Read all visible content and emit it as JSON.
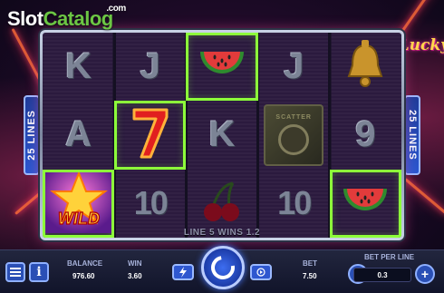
{
  "brand": {
    "name_part1": "Slot",
    "name_part2": "Catalog",
    "suffix": ".com"
  },
  "game_title": "Lucky",
  "lines_indicator": {
    "left": "25 LINES",
    "right": "25 LINES"
  },
  "reels": [
    [
      {
        "symbol": "K",
        "kind": "letter",
        "win": false
      },
      {
        "symbol": "J",
        "kind": "letter",
        "win": false
      },
      {
        "symbol": "watermelon",
        "kind": "watermelon",
        "win": true
      },
      {
        "symbol": "J",
        "kind": "letter",
        "win": false
      },
      {
        "symbol": "bell",
        "kind": "bell",
        "win": false
      }
    ],
    [
      {
        "symbol": "A",
        "kind": "letter",
        "win": false
      },
      {
        "symbol": "7",
        "kind": "seven",
        "win": true
      },
      {
        "symbol": "K",
        "kind": "letter",
        "win": false
      },
      {
        "symbol": "SCATTER",
        "kind": "scatter",
        "win": false
      },
      {
        "symbol": "9",
        "kind": "letter",
        "win": false
      }
    ],
    [
      {
        "symbol": "WILD",
        "kind": "wild",
        "win": true
      },
      {
        "symbol": "10",
        "kind": "number",
        "win": false
      },
      {
        "symbol": "cherries",
        "kind": "cherries",
        "win": false
      },
      {
        "symbol": "10",
        "kind": "number",
        "win": false
      },
      {
        "symbol": "watermelon",
        "kind": "watermelon",
        "win": true
      }
    ]
  ],
  "line_win_text": "LINE 5 WINS 1.2",
  "bottom_bar": {
    "menu_icon": "menu-icon",
    "info_label": "i",
    "balance_label": "BALANCE",
    "balance_value": "976.60",
    "win_label": "WIN",
    "win_value": "3.60",
    "bet_label": "BET",
    "bet_value": "7.50",
    "bet_per_line_label": "BET PER LINE",
    "bet_per_line_value": "0.3",
    "minus_label": "−",
    "plus_label": "+",
    "turbo_icon": "lightning-icon",
    "spin_icon": "spin-icon",
    "autoplay_icon": "autoplay-icon"
  },
  "colors": {
    "win_highlight": "#8dff3a",
    "accent_blue": "#2a57d0",
    "brand_green": "#6cc644"
  }
}
